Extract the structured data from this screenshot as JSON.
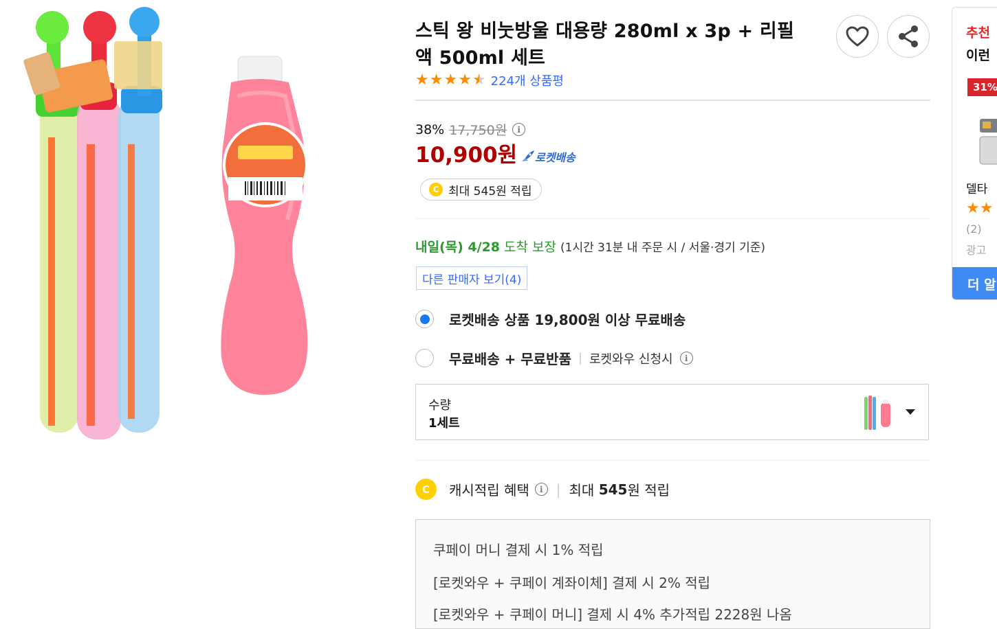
{
  "product": {
    "title_line1": "스틱 왕 비눗방울 대용량 280ml x 3p + 리필",
    "title_line2": "액 500ml 세트",
    "rating_stars": 4.5,
    "review_count": "224개 상품평"
  },
  "price": {
    "discount_rate": "38%",
    "original_price": "17,750원",
    "sale_price": "10,900원",
    "delivery_badge": "로켓배송",
    "cash_reward": "최대 545원 적립"
  },
  "delivery": {
    "date": "내일(목) 4/28",
    "guarantee": "도착 보장",
    "note": "(1시간 31분  내 주문 시 / 서울⋅경기 기준)"
  },
  "seller_button": "다른 판매자 보기(4)",
  "shipping_options": [
    {
      "label": "로켓배송 상품 19,800원 이상 무료배송",
      "selected": true
    },
    {
      "label": "무료배송 + 무료반품",
      "sub": "로켓와우 신청시",
      "selected": false
    }
  ],
  "quantity": {
    "label": "수량",
    "value": "1세트"
  },
  "cash_benefit": {
    "label": "캐시적립 혜택",
    "value_prefix": "최대 ",
    "value_amount": "545",
    "value_suffix": "원 적립"
  },
  "benefit_lines": [
    "쿠페이 머니 결제 시 1% 적립",
    "[로켓와우 + 쿠페이 계좌이체] 결제 시 2% 적립",
    "[로켓와우 + 쿠페이 머니] 결제 시 4% 추가적립 2228원 나옴"
  ],
  "side_panel": {
    "title": "추천",
    "subtitle": "이런",
    "badge": "31%",
    "item_name": "델타",
    "stars": "★★",
    "count": "(2)",
    "ad_label": "광고",
    "more_button": "더 알"
  },
  "icons": {
    "heart": "heart-icon",
    "share": "share-icon",
    "info": "info-icon",
    "rocket": "rocket-icon",
    "coin": "coin-icon",
    "caret": "chevron-down-icon"
  },
  "colors": {
    "price_red": "#ae0000",
    "link_blue": "#346aff",
    "delivery_green": "#2c9a2c",
    "star_orange": "#ff8a00",
    "radio_blue": "#1877f2",
    "coin_yellow": "#ffcf00"
  }
}
